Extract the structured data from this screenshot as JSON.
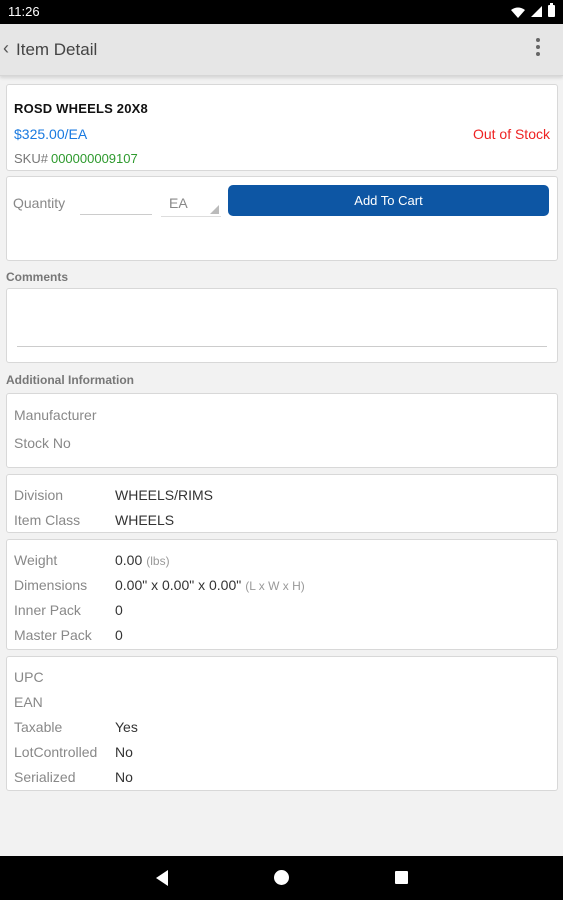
{
  "status_bar": {
    "time": "11:26"
  },
  "app_bar": {
    "title": "Item Detail"
  },
  "product": {
    "name": "ROSD WHEELS 20X8",
    "price": "$325.00/EA",
    "stock_status": "Out of Stock",
    "sku_label": "SKU#",
    "sku_value": "000000009107"
  },
  "order": {
    "quantity_label": "Quantity",
    "quantity_value": "",
    "uom": "EA",
    "add_to_cart_label": "Add To Cart"
  },
  "comments": {
    "label": "Comments",
    "value": ""
  },
  "additional_info": {
    "label": "Additional Information",
    "group1": [
      {
        "label": "Manufacturer",
        "value": ""
      },
      {
        "label": "Stock No",
        "value": ""
      }
    ],
    "group2": [
      {
        "label": "Division",
        "value": "WHEELS/RIMS"
      },
      {
        "label": "Item Class",
        "value": "WHEELS"
      }
    ],
    "group3": [
      {
        "label": "Weight",
        "value": "0.00",
        "unit": "(lbs)"
      },
      {
        "label": "Dimensions",
        "value": "0.00\" x 0.00\" x 0.00\"",
        "unit": "(L x W x H)"
      },
      {
        "label": "Inner Pack",
        "value": "0"
      },
      {
        "label": "Master Pack",
        "value": "0"
      }
    ],
    "group4": [
      {
        "label": "UPC",
        "value": ""
      },
      {
        "label": "EAN",
        "value": ""
      },
      {
        "label": "Taxable",
        "value": "Yes"
      },
      {
        "label": "LotControlled",
        "value": "No"
      },
      {
        "label": "Serialized",
        "value": "No"
      }
    ]
  },
  "colors": {
    "accent_button": "#0d56a4",
    "price": "#1a7ae0",
    "out_of_stock": "#ee2222",
    "sku": "#2e9a2e"
  },
  "icons": {
    "back": "chevron-left-icon",
    "menu": "more-vertical-icon",
    "nav_back": "triangle-back-icon",
    "nav_home": "circle-home-icon",
    "nav_recent": "square-recent-icon"
  }
}
